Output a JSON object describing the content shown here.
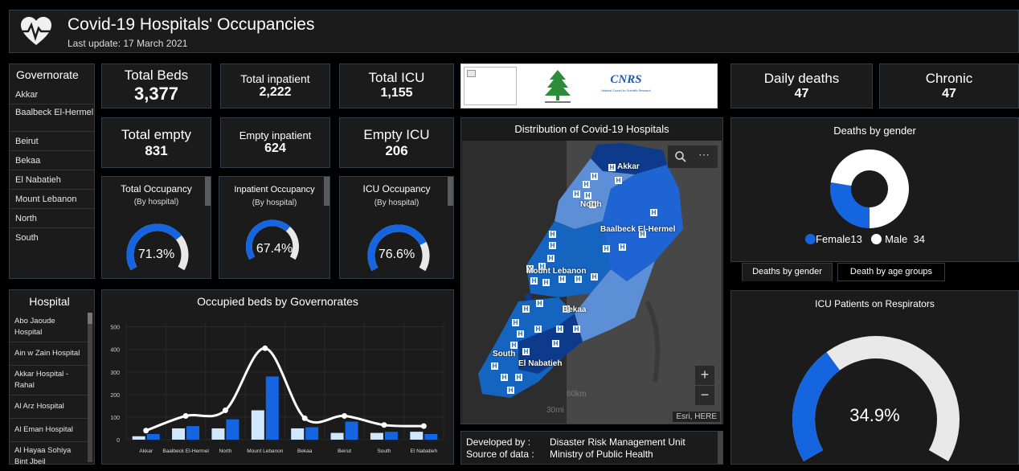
{
  "header": {
    "title": "Covid-19 Hospitals' Occupancies",
    "last_update": "Last update: 17 March 2021"
  },
  "governorate": {
    "title": "Governorate",
    "items": [
      "Akkar",
      "Baalbeck El-Hermel",
      "Beirut",
      "Bekaa",
      "El Nabatieh",
      "Mount Lebanon",
      "North",
      "South"
    ]
  },
  "kpis": {
    "total_beds": {
      "label": "Total Beds",
      "value": "3,377"
    },
    "total_inpatient": {
      "label": "Total inpatient",
      "value": "2,222"
    },
    "total_icu": {
      "label": "Total ICU",
      "value": "1,155"
    },
    "total_empty": {
      "label": "Total empty",
      "value": "831"
    },
    "empty_inpatient": {
      "label": "Empty inpatient",
      "value": "624"
    },
    "empty_icu": {
      "label": "Empty ICU",
      "value": "206"
    },
    "daily_deaths": {
      "label": "Daily deaths",
      "value": "47"
    },
    "chronic": {
      "label": "Chronic",
      "value": "47"
    }
  },
  "gauges": {
    "total": {
      "title": "Total Occupancy",
      "subtitle": "(By hospital)",
      "value": 71.3,
      "display": "71.3%"
    },
    "inpatient": {
      "title": "Inpatient Occupancy",
      "subtitle": "(By hospital)",
      "value": 67.4,
      "display": "67.4%"
    },
    "icu": {
      "title": "ICU Occupancy",
      "subtitle": "(By hospital)",
      "value": 76.6,
      "display": "76.6%"
    },
    "respirators": {
      "title": "ICU Patients on Respirators",
      "value": 34.9,
      "display": "34.9%"
    }
  },
  "hospital": {
    "title": "Hospital",
    "items": [
      "Abo Jaoude Hospital",
      "Ain w Zain Hospital",
      "Akkar Hospital - Rahal",
      "Al Arz Hospital",
      "Al Eman Hospital",
      "Al Hayaa Sohiya Bint Jbeil"
    ]
  },
  "chart_title": "Occupied beds by Governorates",
  "chart_data": {
    "type": "bar",
    "categories": [
      "Akkar",
      "Baalbeck El-Hermel",
      "North",
      "Mount Lebanon",
      "Bekaa",
      "Beirut",
      "South",
      "El Nabatieh"
    ],
    "series": [
      {
        "values": [
          15,
          50,
          50,
          130,
          50,
          30,
          30,
          35
        ],
        "color": "#cfe8ff"
      },
      {
        "values": [
          25,
          60,
          90,
          280,
          55,
          80,
          35,
          25
        ],
        "color": "#1565e0"
      }
    ],
    "line": [
      40,
      105,
      130,
      405,
      95,
      105,
      65,
      60
    ],
    "yticks": [
      0,
      100,
      200,
      300,
      400,
      500
    ],
    "ylim": [
      0,
      520
    ]
  },
  "map": {
    "title": "Distribution of Covid-19 Hospitals",
    "labels": [
      "Akkar",
      "North",
      "Baalbeck El-Hermel",
      "Mount Lebanon",
      "Bekaa",
      "South",
      "El Nabatieh"
    ],
    "scale_km": "60km",
    "scale_mi": "30mi",
    "attribution": "Esri, HERE",
    "marker": "H"
  },
  "logo": {
    "org": "CNRS",
    "org_sub": "National Council for Scientific Research"
  },
  "credits": {
    "developed_by_label": "Developed by :",
    "developed_by": "Disaster Risk Management Unit",
    "source_label": "Source of data :",
    "source": "Ministry of Public Health"
  },
  "deaths_gender": {
    "title": "Deaths by gender",
    "female_label": "Female",
    "female": 13,
    "male_label": "Male",
    "male": 34,
    "female_color": "#1565e0",
    "male_color": "#ffffff"
  },
  "tabs": [
    "Deaths by gender",
    "Death by age groups"
  ],
  "colors": {
    "accent": "#1565e0",
    "panel": "#1b1b1b",
    "border": "#2f3e4d"
  }
}
